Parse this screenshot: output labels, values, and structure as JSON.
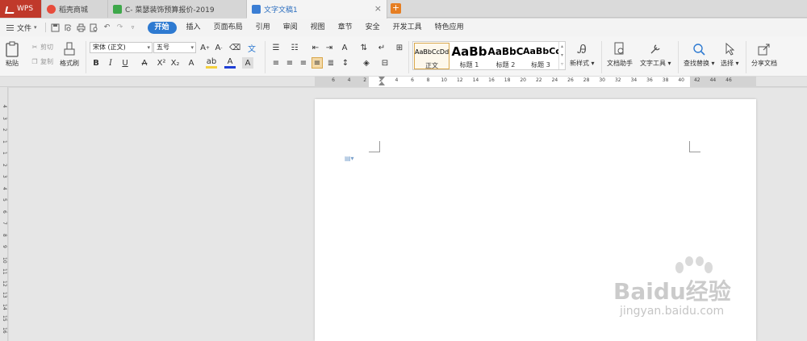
{
  "tabs": {
    "wps": "WPS",
    "store": "稻壳商城",
    "sheet": "C-  菜瑟装饰预算报价-2019",
    "doc": "文字文稿1",
    "new_tab": "+"
  },
  "menu": {
    "file": "文件",
    "items": [
      "开始",
      "插入",
      "页面布局",
      "引用",
      "审阅",
      "视图",
      "章节",
      "安全",
      "开发工具",
      "特色应用"
    ]
  },
  "ribbon": {
    "paste": "粘贴",
    "cut": "剪切",
    "copy": "复制",
    "format_painter": "格式刷",
    "font_name": "宋体 (正文)",
    "font_size": "五号",
    "styles": [
      {
        "preview": "AaBbCcDd",
        "label": "正文"
      },
      {
        "preview": "AaBb",
        "label": "标题 1"
      },
      {
        "preview": "AaBbC",
        "label": "标题 2"
      },
      {
        "preview": "AaBbCc",
        "label": "标题 3"
      }
    ],
    "new_style": "新样式",
    "doc_assistant": "文档助手",
    "text_tools": "文字工具",
    "find_replace": "查找替换",
    "select": "选择",
    "share": "分享文档"
  },
  "ruler": {
    "h_ticks": [
      "6",
      "4",
      "2",
      "2",
      "4",
      "6",
      "8",
      "10",
      "12",
      "14",
      "16",
      "18",
      "20",
      "22",
      "24",
      "26",
      "28",
      "30",
      "32",
      "34",
      "36",
      "38",
      "40",
      "42",
      "44",
      "46"
    ],
    "v_ticks": [
      "4",
      "3",
      "2",
      "1",
      "1",
      "2",
      "3",
      "4",
      "5",
      "6",
      "7",
      "8",
      "9",
      "10",
      "11",
      "12",
      "13",
      "14",
      "15",
      "16"
    ]
  },
  "watermark": {
    "brand": "Baidu经验",
    "url": "jingyan.baidu.com"
  },
  "colors": {
    "accent": "#2e7ad1",
    "wps_tab": "#c0392b",
    "style_selected": "#d9a74a"
  }
}
